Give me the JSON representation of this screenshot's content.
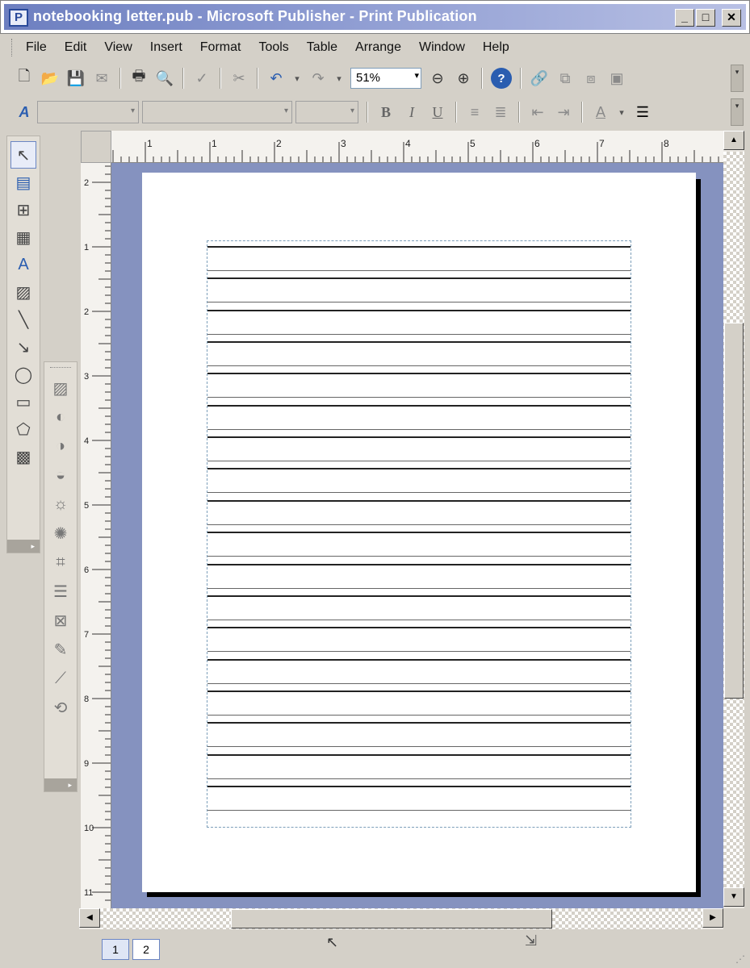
{
  "window": {
    "title": "notebooking letter.pub - Microsoft Publisher - Print Publication",
    "app_icon_letter": "P",
    "minimize": "_",
    "maximize": "□",
    "close": "✕"
  },
  "menu": [
    "File",
    "Edit",
    "View",
    "Insert",
    "Format",
    "Tools",
    "Table",
    "Arrange",
    "Window",
    "Help"
  ],
  "standard_toolbar": {
    "zoom": "51%",
    "dropdown_glyph": "▾",
    "help_glyph": "?",
    "buttons": {
      "new": "🗋",
      "open": "📂",
      "save": "💾",
      "mail": "✉",
      "print": "🖶",
      "preview": "🔍",
      "spell": "✓",
      "cut": "✂",
      "undo": "↶",
      "redo": "↷",
      "zoom_out": "⊖",
      "zoom_in": "⊕",
      "link": "🔗",
      "bring_front": "⧉",
      "send_back": "⧈",
      "group": "▣"
    }
  },
  "formatting_toolbar": {
    "styles_glyph": "A",
    "bold": "B",
    "italic": "I",
    "underline": "U",
    "align_left": "≡",
    "align_center": "≣",
    "indent_dec": "⇤",
    "indent_inc": "⇥",
    "font_color": "A",
    "line_style": "☰"
  },
  "objects_toolbar": {
    "tools": [
      {
        "name": "select-tool",
        "glyph": "↖"
      },
      {
        "name": "text-box-tool",
        "glyph": "▤"
      },
      {
        "name": "insert-table-tool",
        "glyph": "⊞"
      },
      {
        "name": "table-frame-tool",
        "glyph": "▦"
      },
      {
        "name": "wordart-tool",
        "glyph": "A"
      },
      {
        "name": "picture-frame-tool",
        "glyph": "▨"
      },
      {
        "name": "line-tool",
        "glyph": "╲"
      },
      {
        "name": "arrow-tool",
        "glyph": "↘"
      },
      {
        "name": "oval-tool",
        "glyph": "◯"
      },
      {
        "name": "rectangle-tool",
        "glyph": "▭"
      },
      {
        "name": "autoshapes-tool",
        "glyph": "⬠"
      },
      {
        "name": "design-gallery-tool",
        "glyph": "▩"
      }
    ],
    "more_glyph": "▸"
  },
  "picture_toolbar": {
    "tools": [
      {
        "name": "insert-picture-tool",
        "glyph": "▨"
      },
      {
        "name": "color-tool",
        "glyph": "◐"
      },
      {
        "name": "more-contrast-tool",
        "glyph": "◑"
      },
      {
        "name": "less-contrast-tool",
        "glyph": "◒"
      },
      {
        "name": "more-brightness-tool",
        "glyph": "☼"
      },
      {
        "name": "less-brightness-tool",
        "glyph": "✺"
      },
      {
        "name": "crop-tool",
        "glyph": "⌗"
      },
      {
        "name": "line-style-tool",
        "glyph": "☰"
      },
      {
        "name": "text-wrapping-tool",
        "glyph": "⊠"
      },
      {
        "name": "format-picture-tool",
        "glyph": "✎"
      },
      {
        "name": "set-transparent-tool",
        "glyph": "⟋"
      },
      {
        "name": "reset-picture-tool",
        "glyph": "⟲"
      }
    ],
    "more_glyph": "▸"
  },
  "rulers": {
    "horizontal_labels": [
      "1",
      "1",
      "2",
      "3",
      "4",
      "5",
      "6",
      "7",
      "8"
    ],
    "vertical_labels": [
      "2",
      "1",
      "2",
      "3",
      "4",
      "5",
      "6",
      "7",
      "8",
      "9",
      "10",
      "11"
    ]
  },
  "document": {
    "ruled_line_count": 18
  },
  "scrollbars": {
    "up": "▲",
    "down": "▼",
    "left": "◀",
    "right": "▶"
  },
  "status": {
    "pages": [
      "1",
      "2"
    ],
    "active_page": "1",
    "cursor_glyph": "↖",
    "resize_glyph": "⇲",
    "size_grip": "⋰"
  },
  "colors": {
    "workspace": "#8592bf",
    "title_gradient_start": "#6d7fc0",
    "frame_border": "#7d9fba",
    "ruled_line": "#222222"
  }
}
